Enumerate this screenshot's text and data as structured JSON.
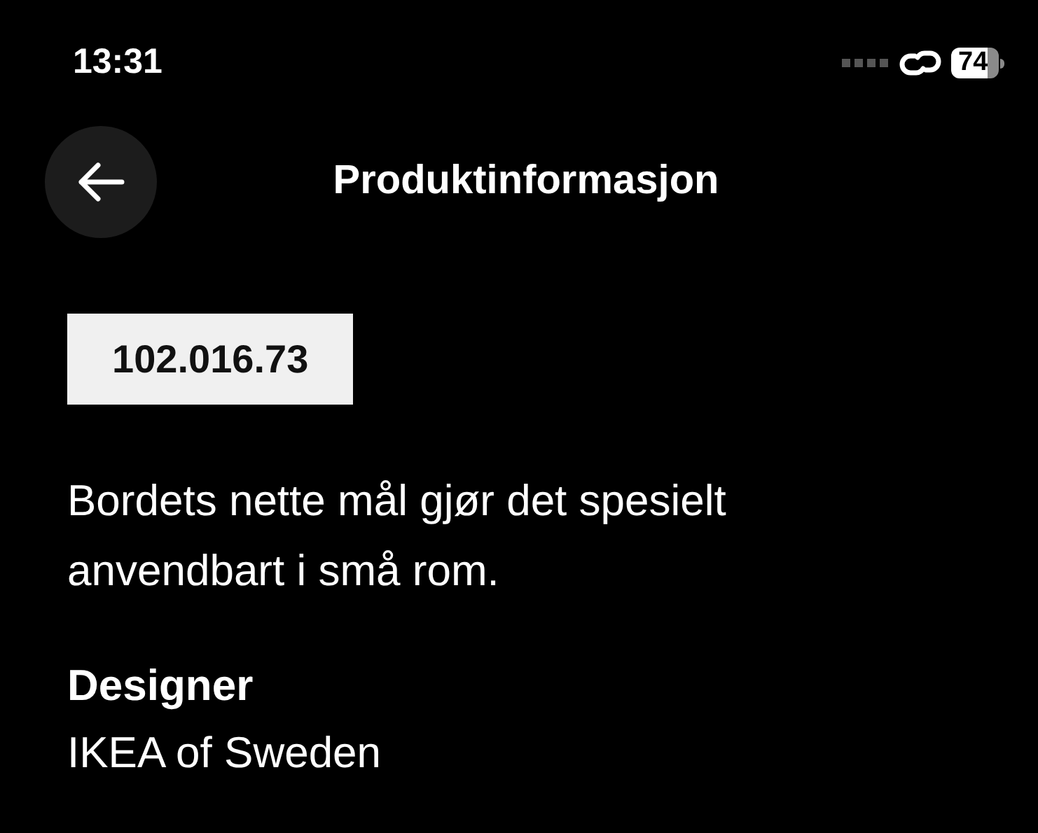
{
  "status_bar": {
    "time": "13:31",
    "battery": "74"
  },
  "header": {
    "title": "Produktinformasjon"
  },
  "article_number": "102.016.73",
  "description": "Bordets nette mål gjør det spesielt anvendbart i små rom.",
  "designer": {
    "label": "Designer",
    "value": "IKEA of Sweden"
  }
}
